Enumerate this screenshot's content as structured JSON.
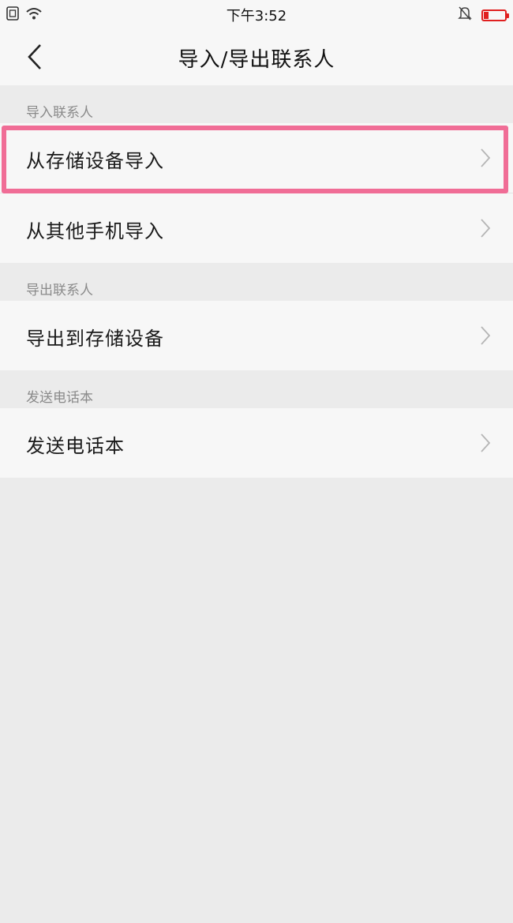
{
  "status_bar": {
    "time": "下午3:52"
  },
  "nav": {
    "title": "导入/导出联系人"
  },
  "sections": [
    {
      "header": "导入联系人",
      "items": [
        "从存储设备导入",
        "从其他手机导入"
      ]
    },
    {
      "header": "导出联系人",
      "items": [
        "导出到存储设备"
      ]
    },
    {
      "header": "发送电话本",
      "items": [
        "发送电话本"
      ]
    }
  ],
  "colors": {
    "highlight": "#f06d96",
    "background": "#ebebeb",
    "row_bg": "#f7f7f7"
  },
  "icons": [
    "sim-card-icon",
    "wifi-icon",
    "bell-muted-icon",
    "battery-low-icon",
    "back-arrow-icon",
    "chevron-right-icon"
  ]
}
